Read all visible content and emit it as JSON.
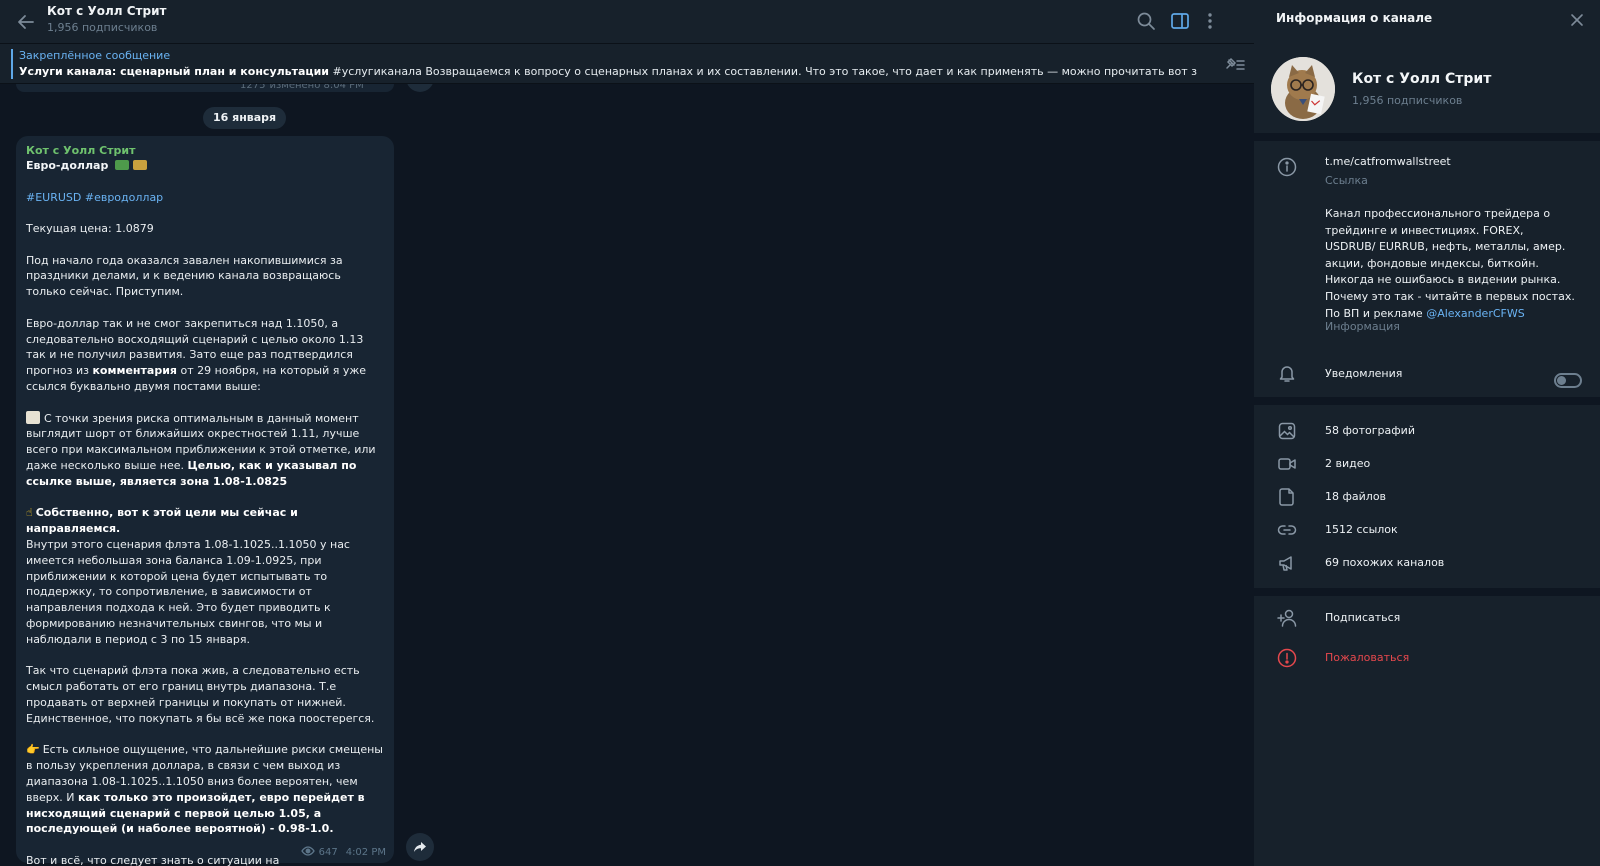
{
  "chat": {
    "title": "Кот с Уолл Стрит",
    "subscribers": "1,956 подписчиков"
  },
  "pinned": {
    "label": "Закреплённое сообщение",
    "bold": "Услуги канала: сценарный план и консультации",
    "text": " #услугиканала  Возвращаемся к вопросу о сценарных планах и их составлении. Что это такое, что дает и как применять — можно прочитать вот з"
  },
  "prev_message": {
    "views": "1275",
    "time": "изменено 8:04 PM"
  },
  "date_pill": "16 января",
  "message": {
    "author": "Кот с Уолл Стрит",
    "title": "Евро-доллар",
    "tags": "#EURUSD #евродоллар",
    "price": "Текущая цена: 1.0879",
    "p1": "Под начало года оказался завален накопившимися за праздники делами, и к ведению канала возвращаюсь только сейчас. Приступим.",
    "p2_a": "Евро-доллар так и не смог закрепиться над 1.1050, а следовательно восходящий сценарий с целью около 1.13 так и не получил развития. Зато еще раз подтвердился прогноз из ",
    "p2_link": "комментария",
    "p2_b": " от 29 ноября, на который я уже ссылся буквально двумя постами выше:",
    "p3_a": "С точки зрения риска оптимальным в данный момент выглядит шорт от ближайших окрестностей 1.11, лучше всего при максимальном приближении к этой отметке, или даже несколько выше нее. ",
    "p3_b": "Целью, как и указывал по ссылке выше, является зона 1.08-1.0825",
    "p4_bold": "Собственно, вот к этой цели мы сейчас и направляемся.",
    "p4_text": "Внутри этого сценария флэта 1.08-1.1025..1.1050 у нас имеется небольшая зона баланса 1.09-1.0925, при приближении к которой цена будет испытывать то поддержку, то сопротивление, в зависимости от направления подхода к ней. Это будет приводить к формированию незначительных свингов, что мы и наблюдали в период с 3 по 15 января.",
    "p5": "Так что сценарий флэта пока жив, а следовательно есть смысл работать от его границ внутрь диапазона. Т.е продавать от верхней границы и покупать от нижней. Единственное, что покупать я бы всё же пока поостерегся.",
    "p6_a": "Есть сильное ощущение, что дальнейшие риски смещены в пользу укрепления доллара, в связи с чем выход из диапазона 1.08-1.1025..1.1050 вниз более вероятен, чем вверх. И ",
    "p6_b": "как только это произойдет, евро перейдет в нисходящий сценарий с первой целью 1.05, а последующей (и наболее вероятной) - 0.98-1.0.",
    "p7": "Вот и всё, что следует знать о ситуации на евро-долларе в ближайшие недели.",
    "views": "647",
    "time": "4:02 PM"
  },
  "panel": {
    "header": "Информация о канале",
    "name": "Кот с Уолл Стрит",
    "subscribers": "1,956 подписчиков",
    "link": "t.me/catfromwallstreet",
    "link_label": "Ссылка",
    "description": "Канал профессионального трейдера о трейдинге и инвестициях. FOREX, USDRUB/ EURRUB, нефть, металлы, амер. акции, фондовые индексы, биткойн. Никогда не ошибаюсь в видении рынка. Почему это так - читайте в первых постах. По ВП и рекламе ",
    "description_link": "@AlexanderCFWS",
    "description_label": "Информация",
    "notifications": "Уведомления",
    "media": {
      "photos": "58 фотографий",
      "videos": "2 видео",
      "files": "18 файлов",
      "links": "1512 ссылок",
      "similar": "69 похожих каналов"
    },
    "subscribe": "Подписаться",
    "report": "Пожаловаться"
  },
  "colors": {
    "accent": "#6ab3f3",
    "author": "#6fc26e",
    "report": "#e5484d",
    "bubble": "#182533",
    "background": "#0e1621",
    "panel": "#17212b"
  },
  "icons": [
    "back-arrow-icon",
    "search-icon",
    "sidebar-toggle-icon",
    "more-vertical-icon",
    "unpin-icon",
    "eye-icon",
    "share-icon",
    "close-icon",
    "info-icon",
    "bell-icon",
    "photo-icon",
    "video-icon",
    "file-icon",
    "link-icon",
    "megaphone-icon",
    "add-user-icon",
    "report-icon"
  ]
}
